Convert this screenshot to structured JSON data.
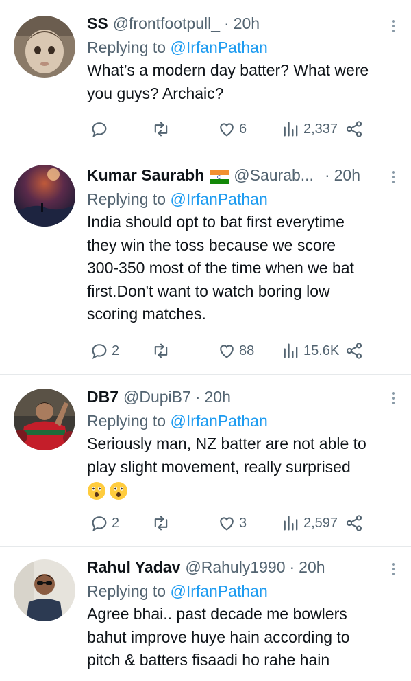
{
  "tweets": [
    {
      "name": "SS",
      "handle": "@frontfootpull_",
      "sep": "·",
      "time": "20h",
      "reply_prefix": "Replying to",
      "reply_to": "@IrfanPathan",
      "text_lines": [
        "What’s a modern day batter? What were",
        "you guys? Archaic?"
      ],
      "replies": "",
      "retweets": "",
      "likes": "6",
      "views": "2,337"
    },
    {
      "name": "Kumar Saurabh",
      "handle": "@Saurab...",
      "sep": "·",
      "time": "20h",
      "reply_prefix": "Replying to",
      "reply_to": "@IrfanPathan",
      "text_lines": [
        "India should opt to bat first everytime",
        "they win the toss because we score",
        "300-350  most of the time when we bat",
        "first.Don't want to watch boring low",
        "scoring matches."
      ],
      "replies": "2",
      "retweets": "",
      "likes": "88",
      "views": "15.6K"
    },
    {
      "name": "DB7",
      "handle": "@DupiB7",
      "sep": "·",
      "time": "20h",
      "reply_prefix": "Replying to",
      "reply_to": "@IrfanPathan",
      "text_lines": [
        "Seriously man, NZ batter are not able to",
        "play slight movement, really surprised"
      ],
      "emoji_count": 2,
      "replies": "2",
      "retweets": "",
      "likes": "3",
      "views": "2,597"
    },
    {
      "name": "Rahul Yadav",
      "handle": "@Rahuly1990",
      "sep": "·",
      "time": "20h",
      "reply_prefix": "Replying to",
      "reply_to": "@IrfanPathan",
      "text_lines": [
        "Agree bhai.. past decade me bowlers",
        "bahut improve huye hain according to",
        "pitch & batters fisaadi ho rahe hain"
      ],
      "replies": "",
      "retweets": "",
      "likes": "",
      "views": ""
    }
  ],
  "icons": {
    "reply": "reply-icon",
    "retweet": "retweet-icon",
    "like": "heart-icon",
    "views": "views-icon",
    "share": "share-icon",
    "more": "more-icon"
  },
  "colors": {
    "link": "#1d9bf0",
    "secondary": "#536471",
    "text": "#0f1419",
    "divider": "#e6e9eb"
  }
}
